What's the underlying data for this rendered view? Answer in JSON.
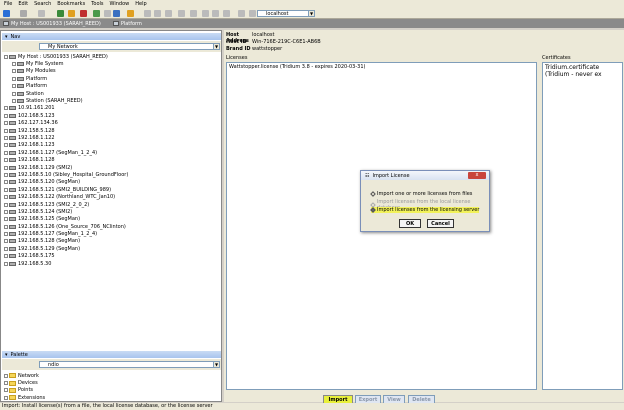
{
  "menu": [
    "File",
    "Edit",
    "Search",
    "Bookmarks",
    "Tools",
    "Window",
    "Help"
  ],
  "toolbar": {
    "address": "localhost"
  },
  "tabs": [
    {
      "label": "My Host : US001933 (SARAH_REED)"
    },
    {
      "label": "Platform"
    }
  ],
  "nav": {
    "title": "Nav",
    "combo": "My Network",
    "tree": [
      {
        "label": "My Host : US001933 (SARAH_REED)",
        "level": 0,
        "icon": "host"
      },
      {
        "label": "My File System",
        "level": 1,
        "icon": "drive"
      },
      {
        "label": "My Modules",
        "level": 1,
        "icon": "modules"
      },
      {
        "label": "Platform",
        "level": 1,
        "icon": "platform"
      },
      {
        "label": "Platform",
        "level": 1,
        "icon": "platform"
      },
      {
        "label": "Station",
        "level": 1,
        "icon": "station"
      },
      {
        "label": "Station (SARAH_REED)",
        "level": 1,
        "icon": "station"
      },
      {
        "label": "10.91.161.201",
        "level": 0,
        "icon": "host"
      },
      {
        "label": "102.168.5.123",
        "level": 0,
        "icon": "host"
      },
      {
        "label": "162.127.134.36",
        "level": 0,
        "icon": "host"
      },
      {
        "label": "192.158.5.128",
        "level": 0,
        "icon": "host"
      },
      {
        "label": "192.168.1.122",
        "level": 0,
        "icon": "host"
      },
      {
        "label": "192.168.1.123",
        "level": 0,
        "icon": "host"
      },
      {
        "label": "192.168.1.127 (SegMan_1_2_4)",
        "level": 0,
        "icon": "host"
      },
      {
        "label": "192.168.1.128",
        "level": 0,
        "icon": "host"
      },
      {
        "label": "192.168.1.129 (SMI2)",
        "level": 0,
        "icon": "host"
      },
      {
        "label": "192.168.5.10 (Sibley_Hospital_GroundFloor)",
        "level": 0,
        "icon": "host"
      },
      {
        "label": "192.168.5.120 (SegMan)",
        "level": 0,
        "icon": "host"
      },
      {
        "label": "192.168.5.121 (SMI2_BUILDING_989)",
        "level": 0,
        "icon": "host"
      },
      {
        "label": "192.168.5.122 (Northland_WTC_Jan10)",
        "level": 0,
        "icon": "host"
      },
      {
        "label": "192.168.5.123 (SMI2_2_0_2)",
        "level": 0,
        "icon": "host"
      },
      {
        "label": "192.168.5.124 (SMI2)",
        "level": 0,
        "icon": "host"
      },
      {
        "label": "192.168.5.125 (SegMan)",
        "level": 0,
        "icon": "host"
      },
      {
        "label": "192.168.5.126 (One_Source_706_NClinton)",
        "level": 0,
        "icon": "host"
      },
      {
        "label": "192.168.5.127 (SegMan_1_2_4)",
        "level": 0,
        "icon": "host"
      },
      {
        "label": "192.168.5.128 (SegMan)",
        "level": 0,
        "icon": "host"
      },
      {
        "label": "192.168.5.129 (SegMan)",
        "level": 0,
        "icon": "host"
      },
      {
        "label": "192.168.5.175",
        "level": 0,
        "icon": "host"
      },
      {
        "label": "192.168.5.30",
        "level": 0,
        "icon": "host"
      }
    ]
  },
  "palette": {
    "title": "Palette",
    "combo": "ndio",
    "items": [
      "Network",
      "Devices",
      "Points",
      "Extensions"
    ]
  },
  "host": {
    "address_label": "Host Address",
    "address": "localhost",
    "id_label": "Host ID",
    "id": "Win-716E-219C-C6E1-AB6B",
    "brand_label": "Brand ID",
    "brand": "wattstopper"
  },
  "licenses": {
    "label": "Licenses",
    "items": [
      "Wattstopper.license (Tridium 3.8 - expires 2020-03-31)"
    ]
  },
  "certificates": {
    "label": "Certificates",
    "items": [
      "Tridium.certificate (Tridium - never ex"
    ]
  },
  "buttons": {
    "import": "Import",
    "export": "Export",
    "view": "View",
    "delete": "Delete"
  },
  "dialog": {
    "title": "Import License",
    "close": "x",
    "options": [
      {
        "label": "Import one or more licenses from files",
        "enabled": true,
        "selected": false
      },
      {
        "label": "Import licenses from the local license database",
        "enabled": false,
        "selected": false
      },
      {
        "label": "Import licenses from the licensing server",
        "enabled": true,
        "selected": true
      }
    ],
    "ok": "OK",
    "cancel": "Cancel",
    "highlight": "#f2f25a"
  },
  "status": "Import: Install license(s) from a file, the local license database, or the license server"
}
